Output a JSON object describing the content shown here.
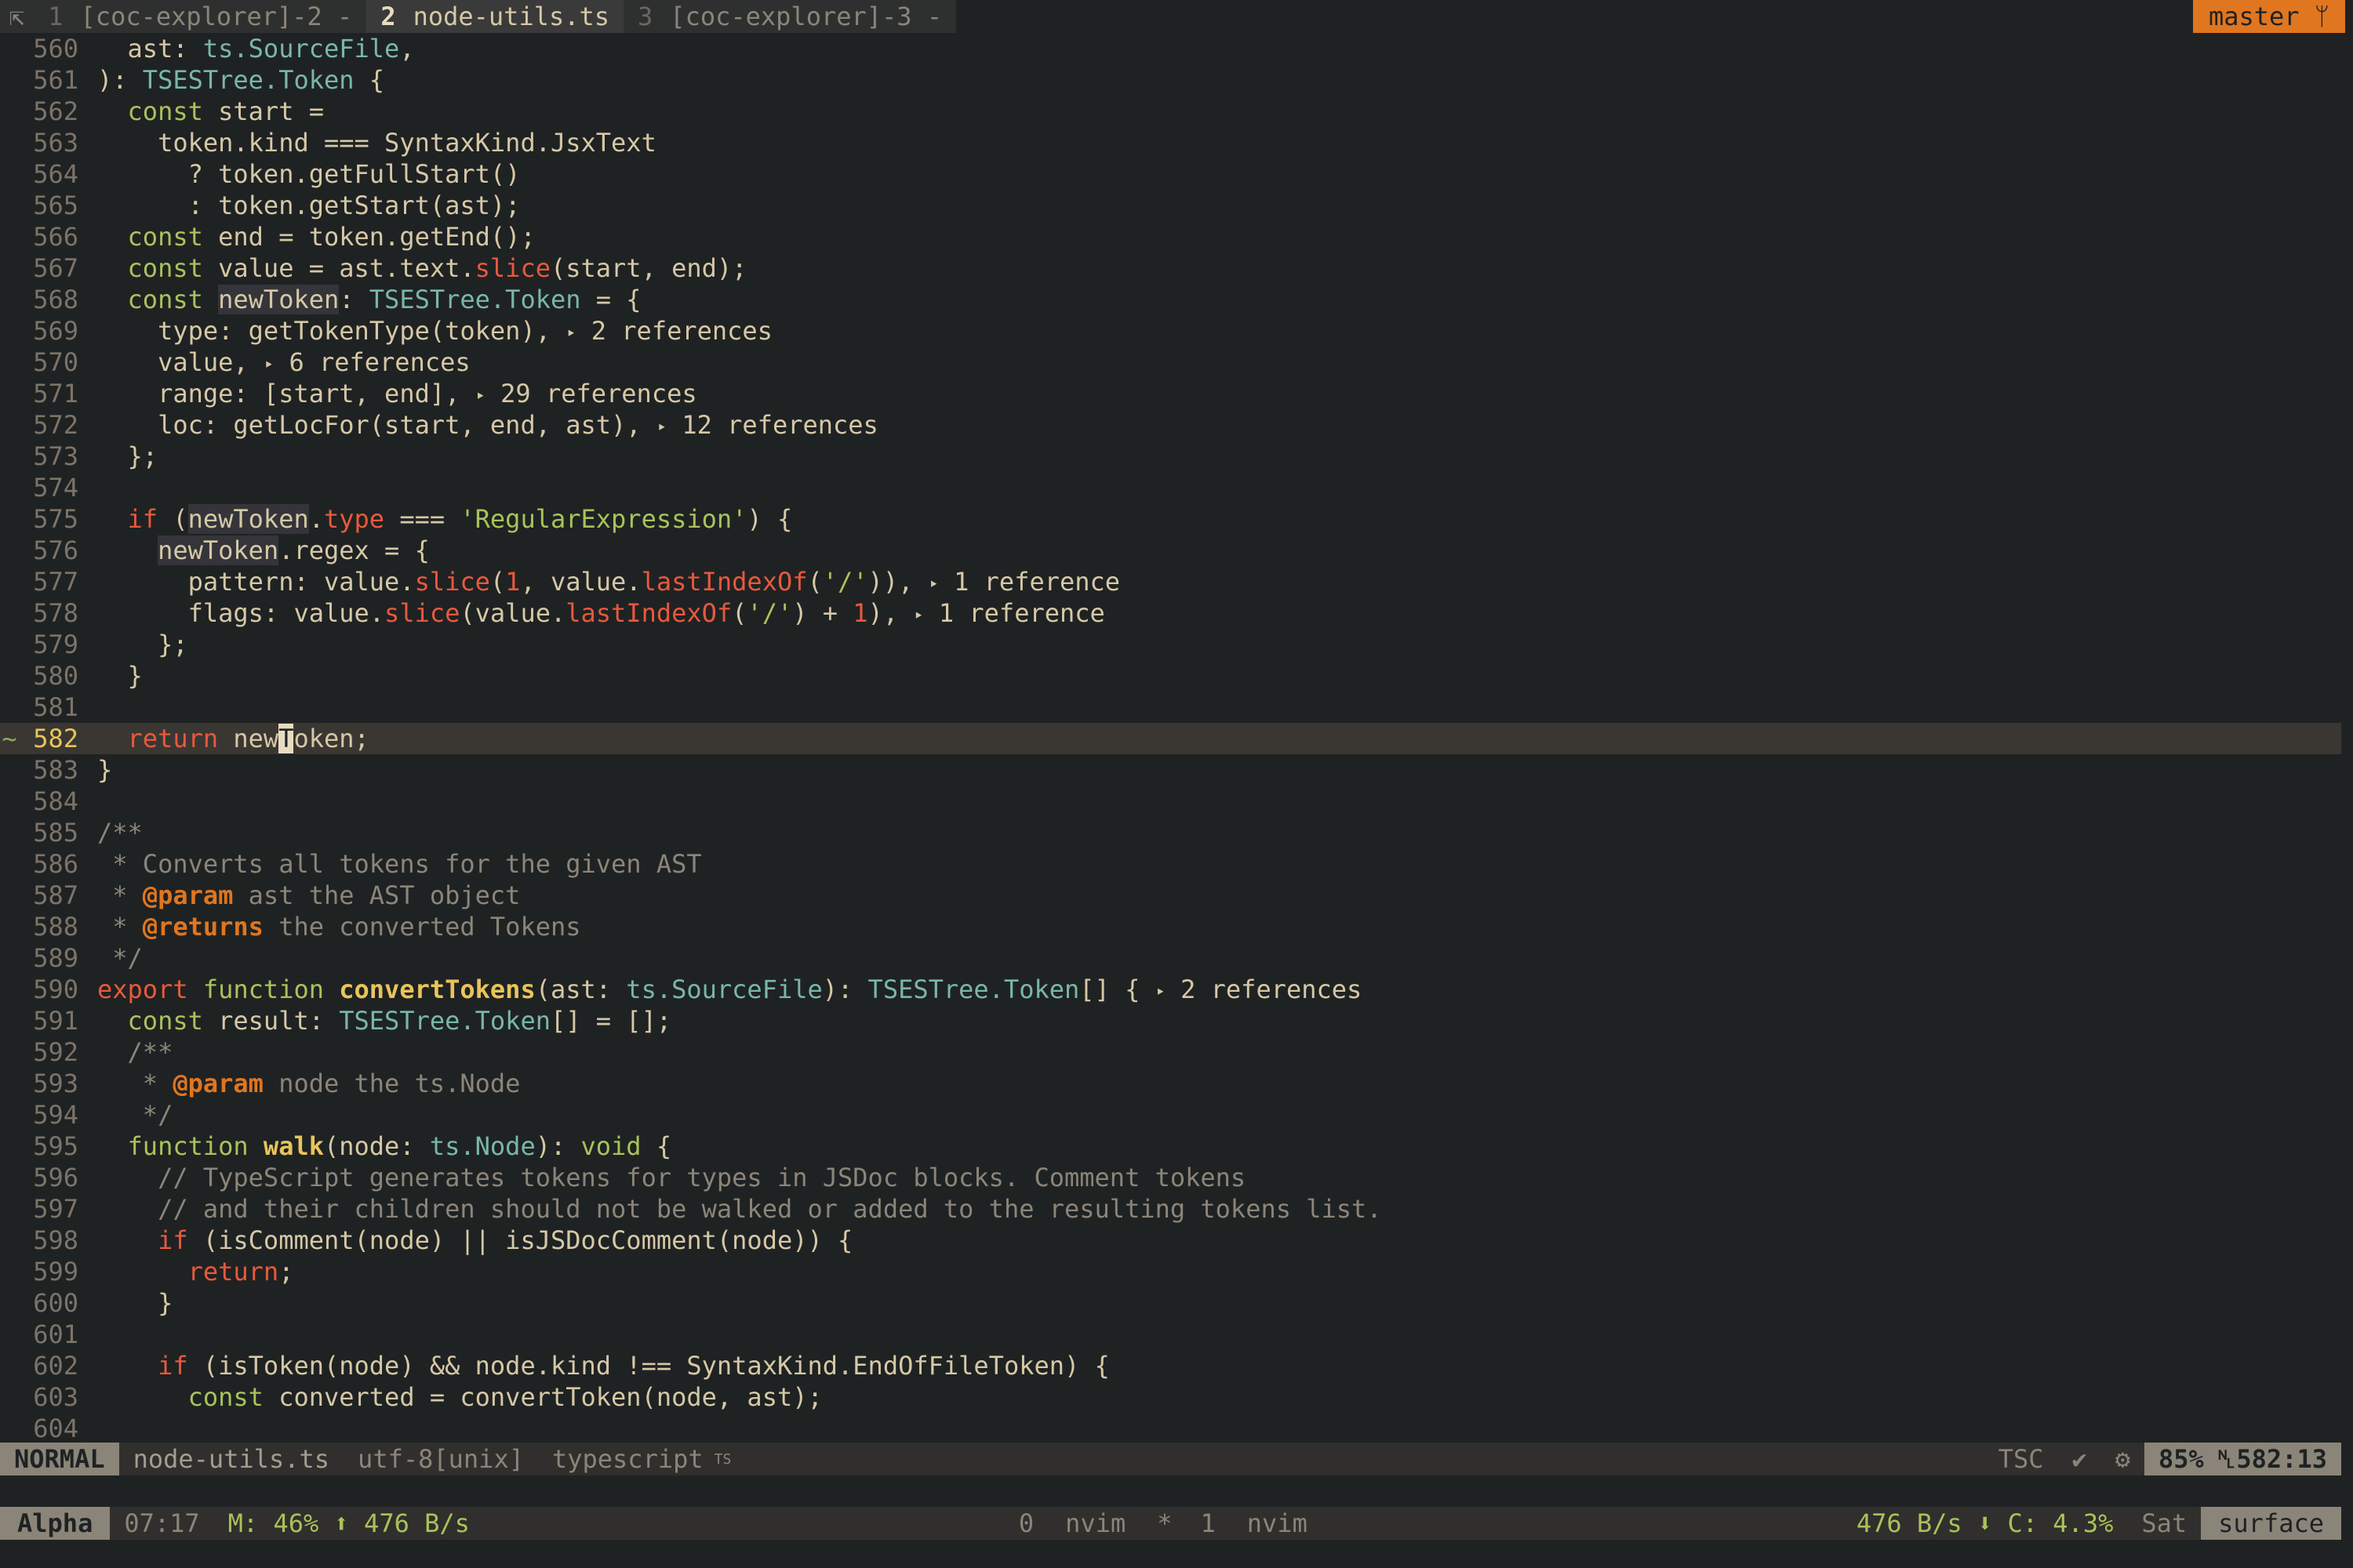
{
  "tabline": {
    "vim_icon": "⇱",
    "tabs": [
      {
        "num": "1",
        "label": "[coc-explorer]-2 -"
      },
      {
        "num": "2",
        "label": "node-utils.ts"
      },
      {
        "num": "3",
        "label": "[coc-explorer]-3 -"
      }
    ],
    "branch": "master ᛘ"
  },
  "editor": {
    "cursor_line": "582",
    "lines": [
      {
        "n": "560",
        "text": "  ast: ts.SourceFile,"
      },
      {
        "n": "561",
        "text": "): TSESTree.Token {"
      },
      {
        "n": "562",
        "text": "  const start ="
      },
      {
        "n": "563",
        "text": "    token.kind === SyntaxKind.JsxText"
      },
      {
        "n": "564",
        "text": "      ? token.getFullStart()"
      },
      {
        "n": "565",
        "text": "      : token.getStart(ast);"
      },
      {
        "n": "566",
        "text": "  const end = token.getEnd();"
      },
      {
        "n": "567",
        "text": "  const value = ast.text.slice(start, end);"
      },
      {
        "n": "568",
        "text": "  const newToken: TSESTree.Token = {"
      },
      {
        "n": "569",
        "text": "    type: getTokenType(token), ‣ 2 references"
      },
      {
        "n": "570",
        "text": "    value, ‣ 6 references"
      },
      {
        "n": "571",
        "text": "    range: [start, end], ‣ 29 references"
      },
      {
        "n": "572",
        "text": "    loc: getLocFor(start, end, ast), ‣ 12 references"
      },
      {
        "n": "573",
        "text": "  };"
      },
      {
        "n": "574",
        "text": ""
      },
      {
        "n": "575",
        "text": "  if (newToken.type === 'RegularExpression') {"
      },
      {
        "n": "576",
        "text": "    newToken.regex = {"
      },
      {
        "n": "577",
        "text": "      pattern: value.slice(1, value.lastIndexOf('/')), ‣ 1 reference"
      },
      {
        "n": "578",
        "text": "      flags: value.slice(value.lastIndexOf('/') + 1), ‣ 1 reference"
      },
      {
        "n": "579",
        "text": "    };"
      },
      {
        "n": "580",
        "text": "  }"
      },
      {
        "n": "581",
        "text": ""
      },
      {
        "n": "582",
        "text": "  return newToken;"
      },
      {
        "n": "583",
        "text": "}"
      },
      {
        "n": "584",
        "text": ""
      },
      {
        "n": "585",
        "text": "/**"
      },
      {
        "n": "586",
        "text": " * Converts all tokens for the given AST"
      },
      {
        "n": "587",
        "text": " * @param ast the AST object"
      },
      {
        "n": "588",
        "text": " * @returns the converted Tokens"
      },
      {
        "n": "589",
        "text": " */"
      },
      {
        "n": "590",
        "text": "export function convertTokens(ast: ts.SourceFile): TSESTree.Token[] { ‣ 2 references"
      },
      {
        "n": "591",
        "text": "  const result: TSESTree.Token[] = [];"
      },
      {
        "n": "592",
        "text": "  /**"
      },
      {
        "n": "593",
        "text": "   * @param node the ts.Node"
      },
      {
        "n": "594",
        "text": "   */"
      },
      {
        "n": "595",
        "text": "  function walk(node: ts.Node): void {"
      },
      {
        "n": "596",
        "text": "    // TypeScript generates tokens for types in JSDoc blocks. Comment tokens"
      },
      {
        "n": "597",
        "text": "    // and their children should not be walked or added to the resulting tokens list."
      },
      {
        "n": "598",
        "text": "    if (isComment(node) || isJSDocComment(node)) {"
      },
      {
        "n": "599",
        "text": "      return;"
      },
      {
        "n": "600",
        "text": "    }"
      },
      {
        "n": "601",
        "text": ""
      },
      {
        "n": "602",
        "text": "    if (isToken(node) && node.kind !== SyntaxKind.EndOfFileToken) {"
      },
      {
        "n": "603",
        "text": "      const converted = convertToken(node, ast);"
      },
      {
        "n": "604",
        "text": ""
      }
    ]
  },
  "statusline": {
    "mode": "NORMAL",
    "filename": "node-utils.ts",
    "encoding": "utf-8[unix]",
    "filetype": "typescript",
    "filetype_badge": "TS",
    "linter": "TSC",
    "check": "✔",
    "gear": "⚙",
    "percent": "85%",
    "position": "␤582:13"
  },
  "tmux": {
    "session": "Alpha",
    "time": "07:17",
    "mem": "M: 46% ⬆ 476 B/s",
    "win0_index": "0",
    "win0_name": "nvim",
    "win_star": "*",
    "win1_index": "1",
    "win1_name": "nvim",
    "net_cpu": "476 B/s ⬇ C: 4.3%",
    "day": "Sat",
    "host": "surface"
  },
  "colors": {
    "background": "#1f2223",
    "keyword": "#e8593c",
    "type": "#78b8a4",
    "string": "#a9c25a",
    "accent": "#e0761f",
    "cursorline": "#3a3733"
  }
}
